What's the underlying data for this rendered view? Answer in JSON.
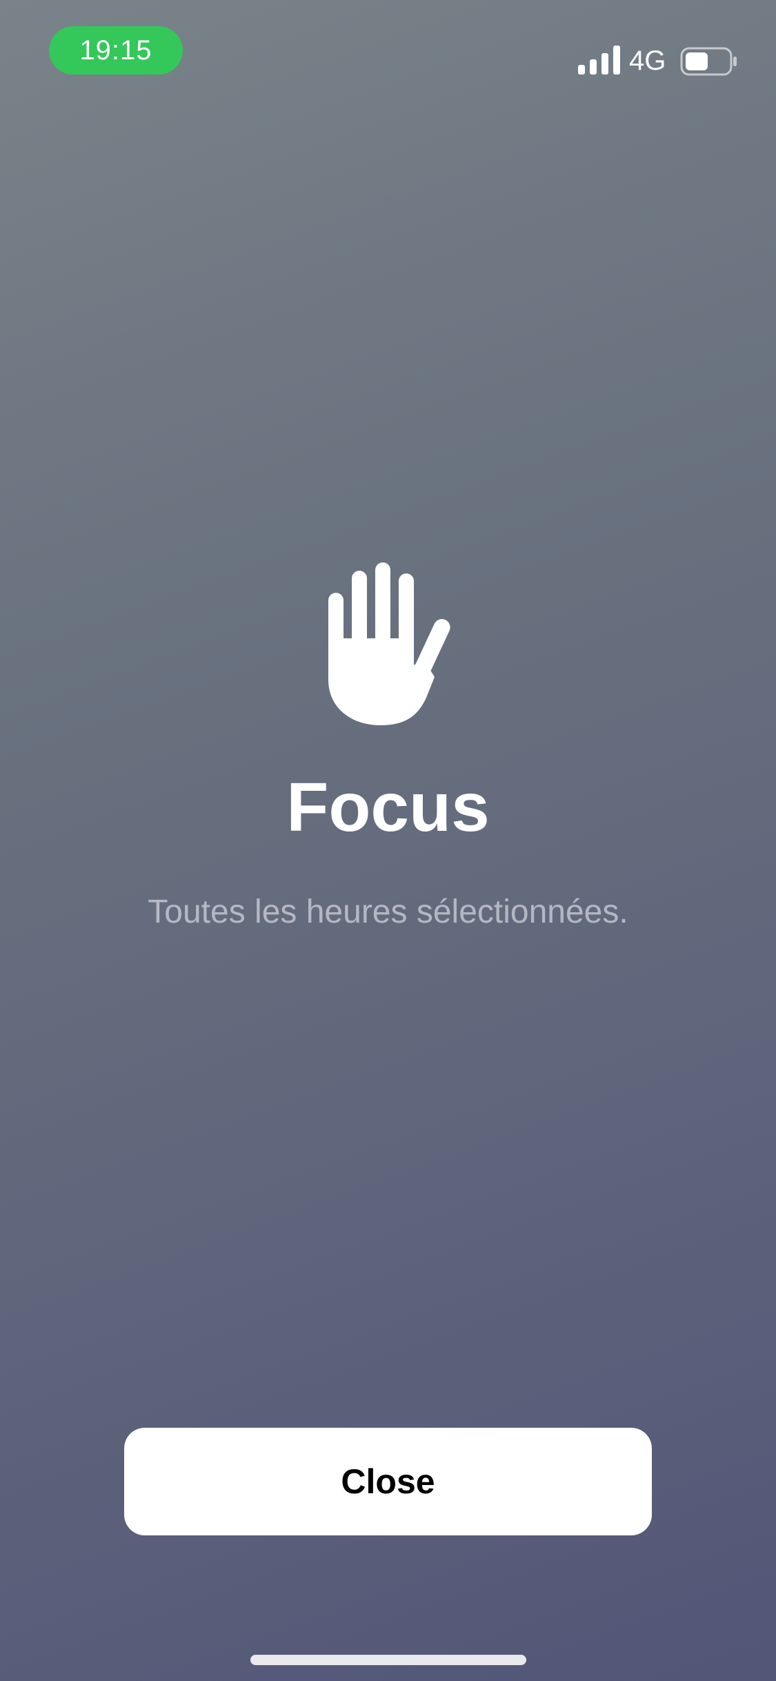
{
  "status_bar": {
    "time": "19:15",
    "network": "4G",
    "signal_icon": "cellular-signal-icon",
    "battery_icon": "battery-icon",
    "time_pill_color": "#34c759"
  },
  "main": {
    "icon": "raised-hand-icon",
    "title": "Focus",
    "subtitle": "Toutes les heures sélectionnées."
  },
  "actions": {
    "close_label": "Close"
  },
  "colors": {
    "background_top": "#7a8389",
    "background_bottom": "#525677",
    "button_background": "#ffffff",
    "button_text": "#000000"
  }
}
